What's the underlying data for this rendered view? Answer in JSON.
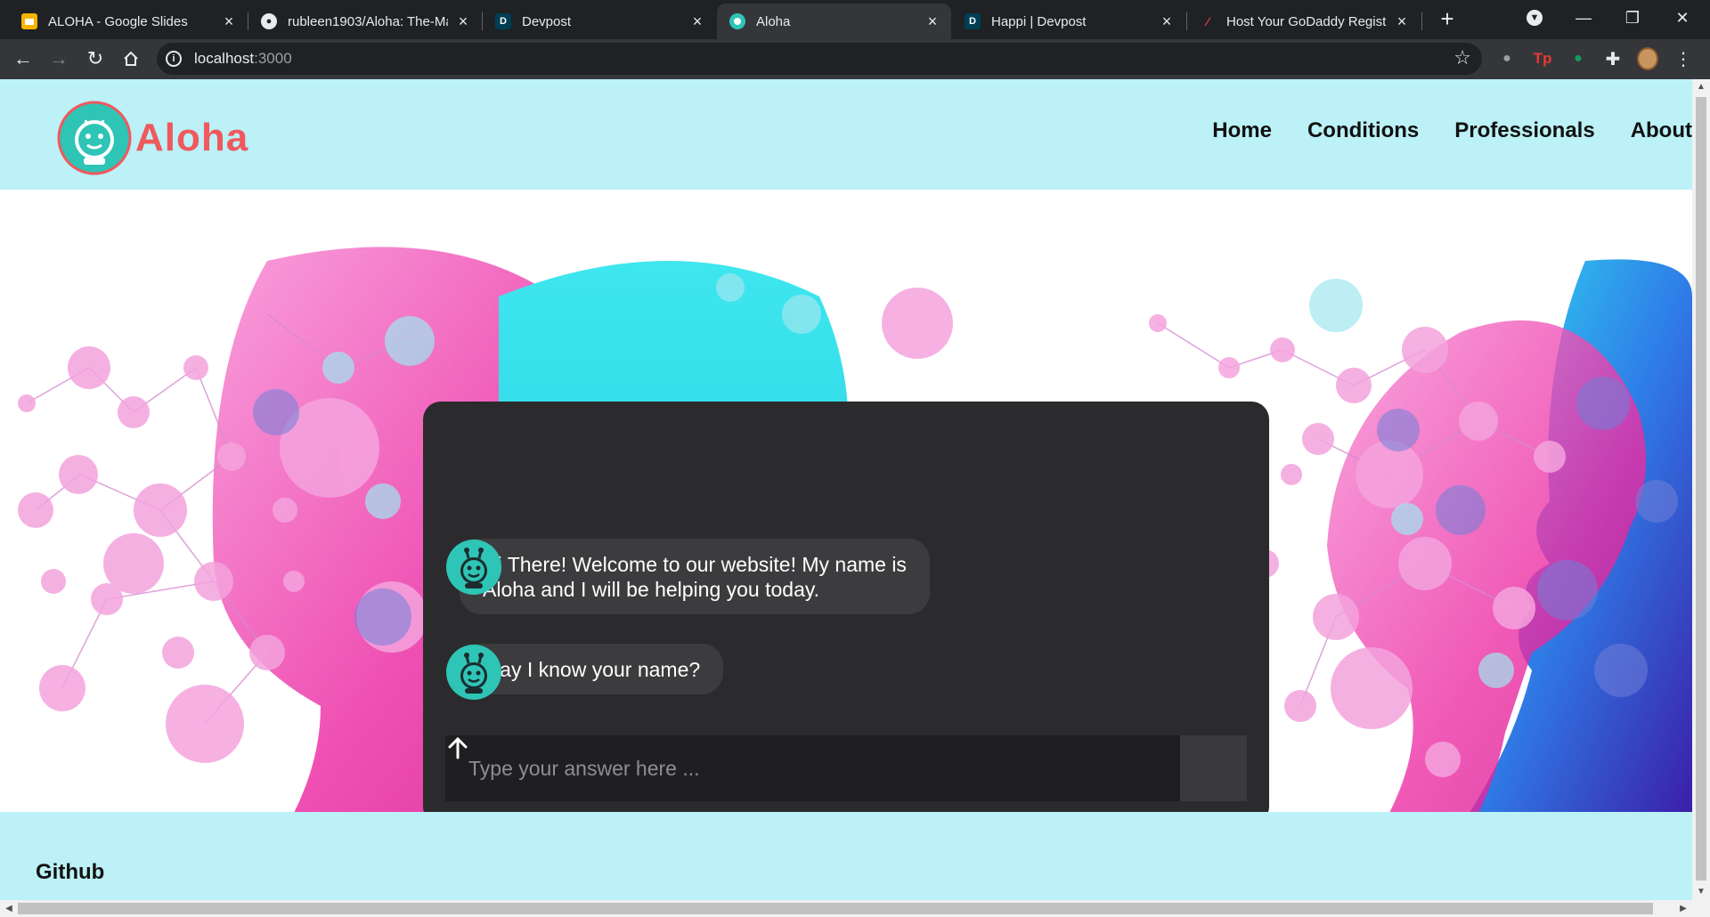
{
  "browser": {
    "tabs": [
      {
        "title": "ALOHA - Google Slides",
        "icon": "google-slides-icon",
        "color": "#f4b400"
      },
      {
        "title": "rubleen1903/Aloha: The-Ma",
        "icon": "github-icon",
        "color": "#ffffff"
      },
      {
        "title": "Devpost",
        "icon": "devpost-icon",
        "color": "#003e54"
      },
      {
        "title": "Aloha",
        "icon": "aloha-icon",
        "color": "#2ec4b6"
      },
      {
        "title": "Happi | Devpost",
        "icon": "devpost-icon",
        "color": "#003e54"
      },
      {
        "title": "Host Your GoDaddy Registr",
        "icon": "godaddy-icon",
        "color": "#e0403f"
      }
    ],
    "active_tab": 3,
    "address": {
      "host": "localhost",
      "port": ":3000"
    }
  },
  "site": {
    "logo_text": "Aloha",
    "nav": [
      "Home",
      "Conditions",
      "Professionals",
      "About"
    ],
    "footer_link": "Github"
  },
  "chat": {
    "messages": [
      {
        "line1": "Hi There! Welcome to our website! My name is",
        "line2": "Aloha and I will be helping you today."
      },
      {
        "line1": "May I know your name?"
      }
    ],
    "input_placeholder": "Type your answer here ..."
  },
  "colors": {
    "header_bg": "#bbf1f7",
    "brand_red": "#f0595d",
    "brand_teal": "#2ec4b6",
    "chat_bg": "#2b2b2d",
    "bubble_bg": "#3c3c3e"
  }
}
